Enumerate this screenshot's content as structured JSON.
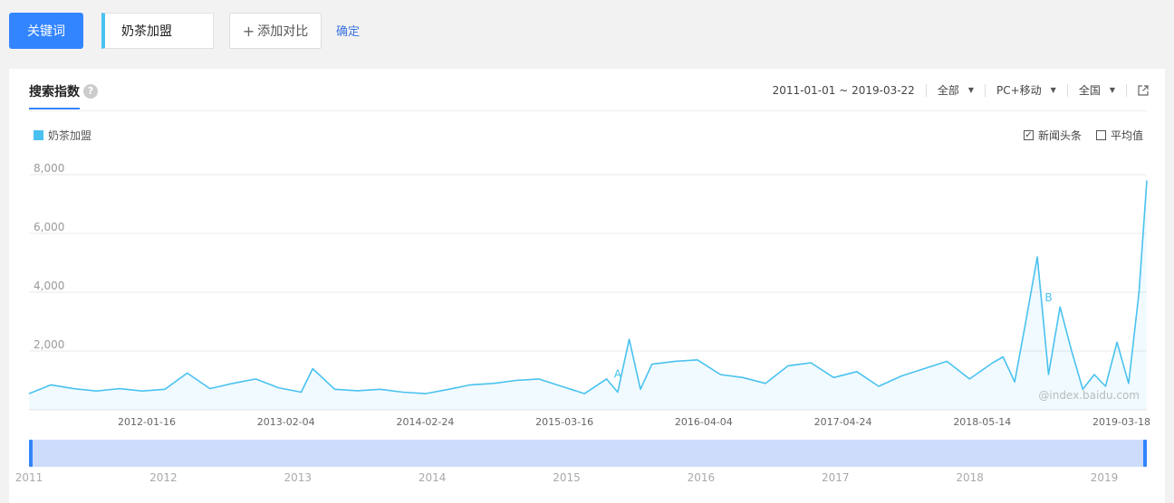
{
  "toolbar": {
    "keyword_button": "关键词",
    "keyword_value": "奶茶加盟",
    "add_compare": "添加对比",
    "confirm": "确定"
  },
  "panel": {
    "tab_label": "搜索指数",
    "help_glyph": "?",
    "date_range": "2011-01-01 ~ 2019-03-22",
    "source_filter": "全部",
    "device_filter": "PC+移动",
    "region_filter": "全国",
    "legend_label": "奶茶加盟",
    "news_label": "新闻头条",
    "avg_label": "平均值",
    "news_checked": true,
    "avg_checked": false,
    "watermark": "@index.baidu.com"
  },
  "colors": {
    "accent": "#3385ff",
    "series": "#49c2f0",
    "link": "#3b73e0"
  },
  "chart_data": {
    "type": "area",
    "x_range": [
      "2011-01-01",
      "2019-03-22"
    ],
    "ylim": [
      0,
      8000
    ],
    "yticks": [
      "2,000",
      "4,000",
      "6,000",
      "8,000"
    ],
    "ytick_values": [
      2000,
      4000,
      6000,
      8000
    ],
    "xticks": [
      "2012-01-16",
      "2013-02-04",
      "2014-02-24",
      "2015-03-16",
      "2016-04-04",
      "2017-04-24",
      "2018-05-14",
      "2019-03-18"
    ],
    "grid": true,
    "series": [
      {
        "name": "奶茶加盟",
        "x": [
          "2011-01-01",
          "2011-03-01",
          "2011-05-01",
          "2011-07-01",
          "2011-09-01",
          "2011-11-01",
          "2012-01-01",
          "2012-03-01",
          "2012-05-01",
          "2012-07-01",
          "2012-09-01",
          "2012-11-01",
          "2013-01-01",
          "2013-02-01",
          "2013-04-01",
          "2013-06-01",
          "2013-08-01",
          "2013-10-01",
          "2013-12-01",
          "2014-02-01",
          "2014-04-01",
          "2014-06-01",
          "2014-08-01",
          "2014-10-01",
          "2014-12-01",
          "2015-02-01",
          "2015-04-01",
          "2015-05-01",
          "2015-06-01",
          "2015-07-01",
          "2015-08-01",
          "2015-10-01",
          "2015-12-01",
          "2016-02-01",
          "2016-04-01",
          "2016-06-01",
          "2016-08-01",
          "2016-10-01",
          "2016-12-01",
          "2017-02-01",
          "2017-04-01",
          "2017-06-01",
          "2017-08-01",
          "2017-10-01",
          "2017-12-01",
          "2018-02-01",
          "2018-03-01",
          "2018-04-01",
          "2018-05-01",
          "2018-06-01",
          "2018-07-01",
          "2018-08-01",
          "2018-09-01",
          "2018-10-01",
          "2018-11-01",
          "2018-12-01",
          "2019-01-01",
          "2019-02-01",
          "2019-03-01",
          "2019-03-22"
        ],
        "values": [
          550,
          850,
          720,
          640,
          720,
          640,
          700,
          1250,
          720,
          900,
          1050,
          750,
          600,
          1400,
          700,
          650,
          700,
          600,
          550,
          700,
          850,
          900,
          1000,
          1050,
          800,
          550,
          1050,
          600,
          2400,
          700,
          1550,
          1650,
          1700,
          1200,
          1100,
          900,
          1500,
          1600,
          1100,
          1300,
          800,
          1150,
          1400,
          1650,
          1050,
          1600,
          1800,
          950,
          3000,
          5200,
          1200,
          3500,
          2000,
          700,
          1200,
          800,
          2300,
          900,
          4000,
          7800
        ]
      }
    ],
    "annotations": [
      {
        "label": "A",
        "x": "2015-05-01",
        "y": 1100
      },
      {
        "label": "B",
        "x": "2018-07-01",
        "y": 3700
      }
    ],
    "navigator": {
      "labels": [
        "2011",
        "2012",
        "2013",
        "2014",
        "2015",
        "2016",
        "2017",
        "2018",
        "2019"
      ],
      "years": [
        2011,
        2012,
        2013,
        2014,
        2015,
        2016,
        2017,
        2018,
        2019
      ]
    }
  }
}
